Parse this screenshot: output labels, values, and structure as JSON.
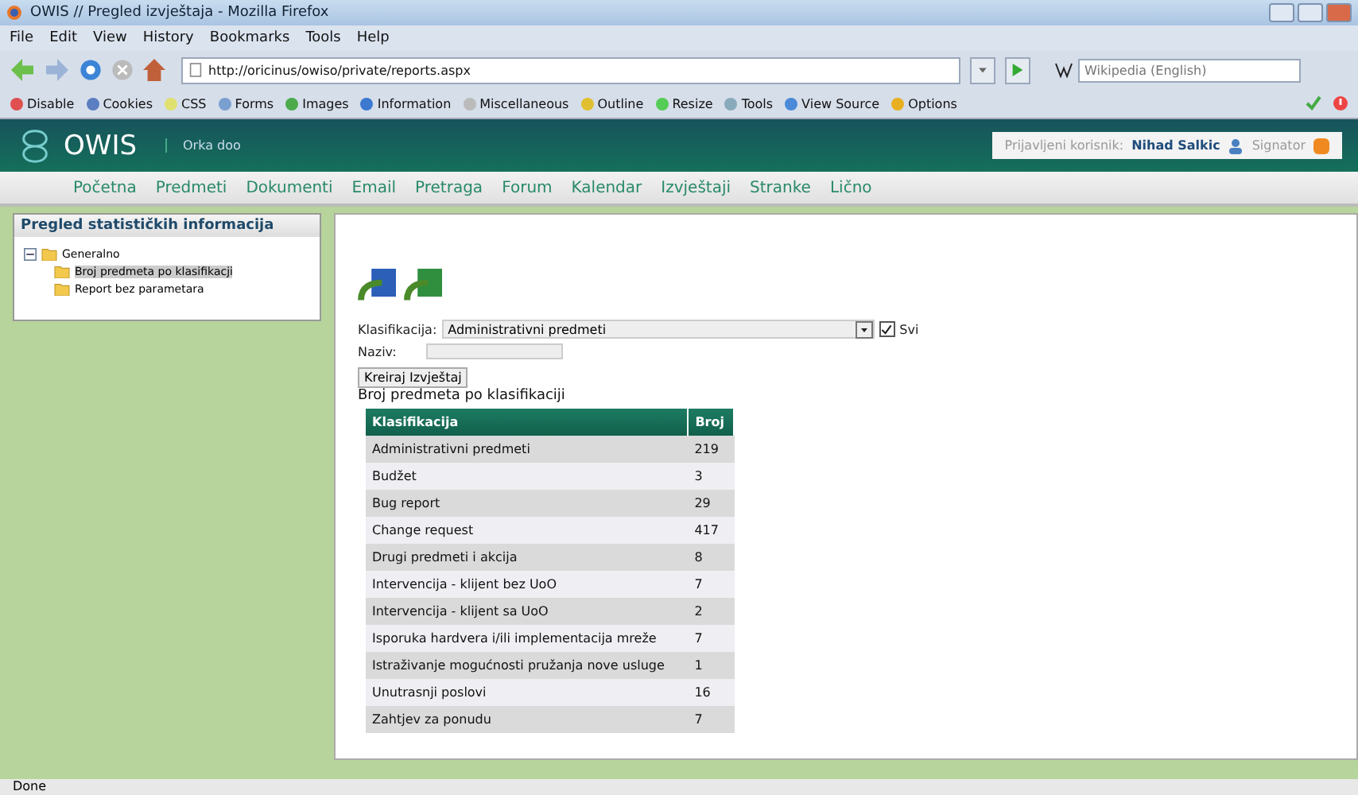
{
  "window": {
    "title": "OWIS // Pregled izvještaja - Mozilla Firefox"
  },
  "menu": [
    "File",
    "Edit",
    "View",
    "History",
    "Bookmarks",
    "Tools",
    "Help"
  ],
  "address": {
    "value": "http://oricinus/owiso/private/reports.aspx"
  },
  "search": {
    "placeholder": "Wikipedia (English)"
  },
  "addons": [
    "Disable",
    "Cookies",
    "CSS",
    "Forms",
    "Images",
    "Information",
    "Miscellaneous",
    "Outline",
    "Resize",
    "Tools",
    "View Source",
    "Options"
  ],
  "header": {
    "logo": "OWIS",
    "company": "Orka doo",
    "user_label": "Prijavljeni korisnik:",
    "user_name": "Nihad Salkic",
    "role": "Signator"
  },
  "nav": [
    "Početna",
    "Predmeti",
    "Dokumenti",
    "Email",
    "Pretraga",
    "Forum",
    "Kalendar",
    "Izvještaji",
    "Stranke",
    "Lično"
  ],
  "sidebar": {
    "title": "Pregled statističkih informacija",
    "tree": [
      {
        "label": "Generalno",
        "expanded": true,
        "selected": false,
        "children": [
          {
            "label": "Broj predmeta po klasifikacji",
            "selected": true
          },
          {
            "label": "Report bez parametara",
            "selected": false
          }
        ]
      }
    ]
  },
  "form": {
    "klasifikacija_label": "Klasifikacija:",
    "klasifikacija_value": "Administrativni predmeti",
    "svi_label": "Svi",
    "svi_checked": true,
    "naziv_label": "Naziv:",
    "button": "Kreiraj Izvještaj",
    "report_title": "Broj predmeta po klasifikaciji"
  },
  "table": {
    "columns": [
      "Klasifikacija",
      "Broj"
    ],
    "rows": [
      {
        "name": "Administrativni predmeti",
        "count": "219"
      },
      {
        "name": "Budžet",
        "count": "3"
      },
      {
        "name": "Bug report",
        "count": "29"
      },
      {
        "name": "Change request",
        "count": "417"
      },
      {
        "name": "Drugi predmeti i akcija",
        "count": "8"
      },
      {
        "name": "Intervencija - klijent bez UoO",
        "count": "7"
      },
      {
        "name": "Intervencija - klijent sa UoO",
        "count": "2"
      },
      {
        "name": "Isporuka hardvera i/ili implementacija mreže",
        "count": "7"
      },
      {
        "name": "Istraživanje mogućnosti pružanja nove usluge",
        "count": "1"
      },
      {
        "name": "Unutrasnji poslovi",
        "count": "16"
      },
      {
        "name": "Zahtjev za ponudu",
        "count": "7"
      }
    ]
  },
  "status_bar": "Done"
}
